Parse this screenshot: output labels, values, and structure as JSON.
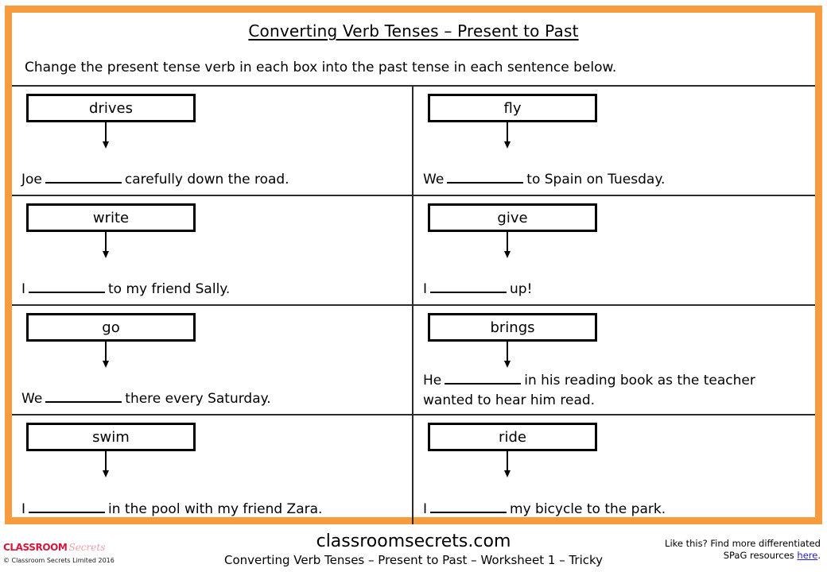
{
  "worksheet": {
    "title": "Converting Verb Tenses – Present to Past",
    "instruction": "Change the present tense verb in each box into the past tense in each sentence below.",
    "border_color": "#F79B3E",
    "exercises": [
      {
        "verb": "drives",
        "sentence_before": "Joe",
        "sentence_after": "carefully down the road.",
        "full_sentence": "Joe __________ carefully down the road."
      },
      {
        "verb": "fly",
        "sentence_before": "We",
        "sentence_after": "to Spain on Tuesday.",
        "full_sentence": "We __________ to Spain on Tuesday."
      },
      {
        "verb": "write",
        "sentence_before": "I",
        "sentence_after": "to my friend Sally.",
        "full_sentence": "I __________ to my friend Sally."
      },
      {
        "verb": "give",
        "sentence_before": "I",
        "sentence_after": "up!",
        "full_sentence": "I __________ up!"
      },
      {
        "verb": "go",
        "sentence_before": "We",
        "sentence_after": "there every Saturday.",
        "full_sentence": "We __________ there every Saturday."
      },
      {
        "verb": "brings",
        "sentence_before": "He",
        "sentence_after": "in his reading book as the teacher wanted to hear him read.",
        "full_sentence": "He __________ in his reading book as the teacher wanted to hear him read."
      },
      {
        "verb": "swim",
        "sentence_before": "I",
        "sentence_after": "in the pool with my friend Zara.",
        "full_sentence": "I __________ in the pool with my friend Zara."
      },
      {
        "verb": "ride",
        "sentence_before": "I",
        "sentence_after": "my bicycle to the park.",
        "full_sentence": "I __________ my bicycle to the park."
      }
    ]
  },
  "footer": {
    "logo": {
      "brand_primary": "CLASSROOM",
      "brand_secondary": "Secrets",
      "copyright": "© Classroom Secrets Limited 2016",
      "primary_color": "#D4183C"
    },
    "site_name": "classroomsecrets.com",
    "sheet_caption": "Converting Verb Tenses – Present to Past – Worksheet 1 – Tricky",
    "promo_line1": "Like this? Find more differentiated",
    "promo_line2_prefix": "SPaG resources ",
    "promo_link": "here",
    "promo_line2_suffix": ".",
    "link_color": "#2222CC"
  }
}
